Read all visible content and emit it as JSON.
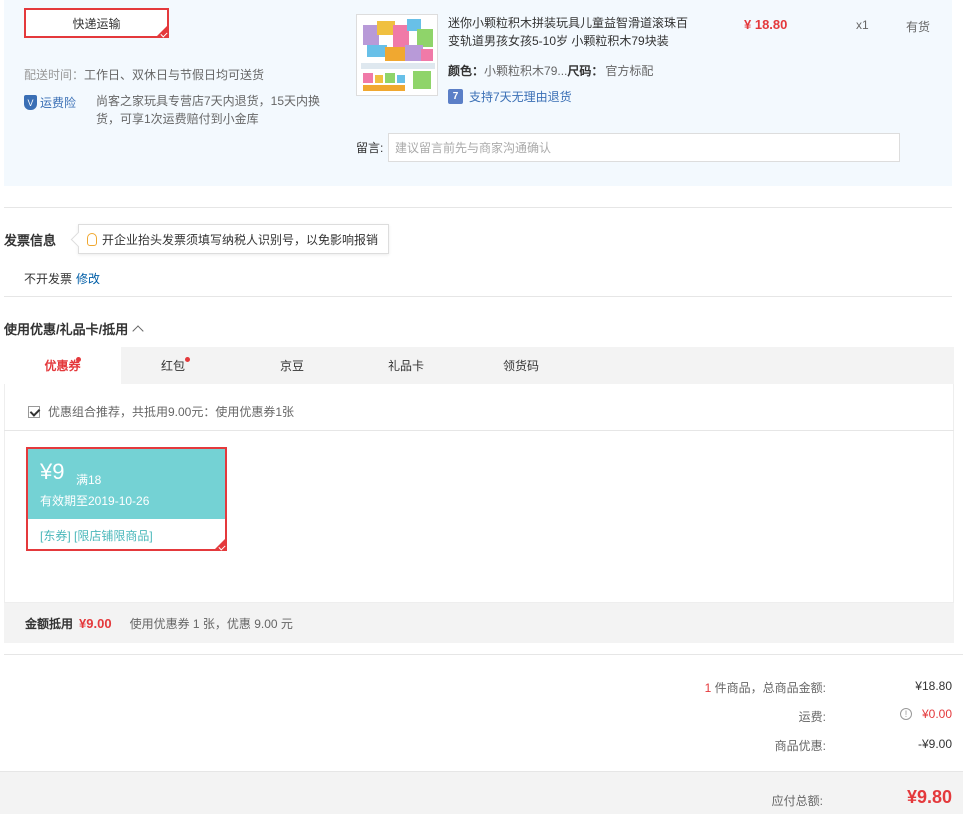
{
  "shipping": {
    "method_label": "快递运输",
    "delivery_label": "配送时间：",
    "delivery_value": "工作日、双休日与节假日均可送货",
    "insurance_badge": "运费险",
    "insurance_text": "尚客之家玩具专营店7天内退货，15天内换货，可享1次运费赔付到小金库"
  },
  "product": {
    "title": "迷你小颗粒积木拼装玩具儿童益智滑道滚珠百变轨道男孩女孩5-10岁 小颗粒积木79块装",
    "color_label": "颜色：",
    "color_value": "小颗粒积木79...",
    "size_label": "尺码：",
    "size_value": "官方标配",
    "return_policy": "支持7天无理由退货",
    "return_icon_text": "7",
    "price": "¥ 18.80",
    "quantity": "x1",
    "stock": "有货",
    "message_label": "留言:",
    "message_placeholder": "建议留言前先与商家沟通确认"
  },
  "invoice": {
    "title": "发票信息",
    "tip": "开企业抬头发票须填写纳税人识别号，以免影响报销",
    "value": "不开发票",
    "edit_label": "修改"
  },
  "coupons": {
    "section_title": "使用优惠/礼品卡/抵用",
    "tabs": [
      {
        "label": "优惠券",
        "dot": true
      },
      {
        "label": "红包",
        "dot": true
      },
      {
        "label": "京豆",
        "dot": false
      },
      {
        "label": "礼品卡",
        "dot": false
      },
      {
        "label": "领货码",
        "dot": false
      }
    ],
    "combo_text": "优惠组合推荐，共抵用9.00元：使用优惠券1张",
    "card": {
      "amount": "¥9",
      "condition": "满18",
      "expiry": "有效期至2019-10-26",
      "tags": "[东券]  [限店铺限商品]"
    },
    "summary_label": "金额抵用",
    "summary_amount": "¥9.00",
    "summary_desc": "使用优惠券 1 张，优惠 9.00 元"
  },
  "totals": {
    "item_count": "1",
    "items_label": " 件商品，总商品金额:",
    "items_value": "¥18.80",
    "shipping_label": "运费:",
    "shipping_value": "¥0.00",
    "discount_label": "商品优惠:",
    "discount_value": "-¥9.00",
    "pay_label": "应付总额:",
    "pay_value": "¥9.80"
  },
  "colors": {
    "accent_red": "#e4393c",
    "link_blue": "#005ea7",
    "coupon_teal": "#74d2d4"
  }
}
